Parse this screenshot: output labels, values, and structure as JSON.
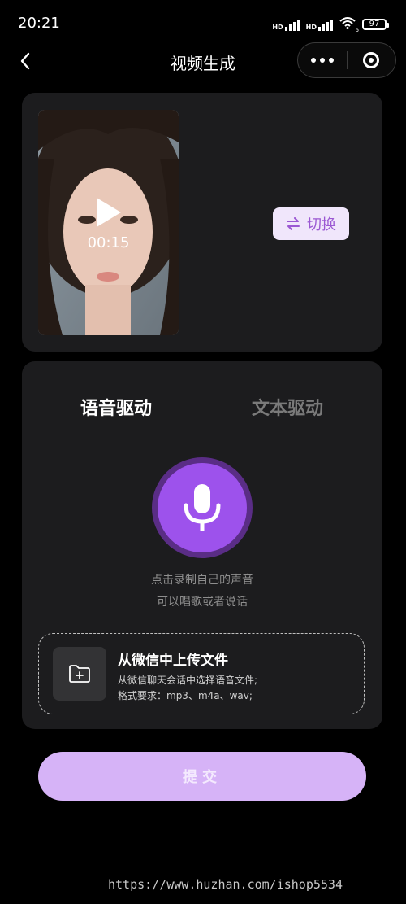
{
  "status_bar": {
    "time": "20:21",
    "network_labels": [
      "HD",
      "HD"
    ],
    "wifi_sub": "6",
    "battery": "97"
  },
  "nav": {
    "title": "视频生成",
    "back_icon": "chevron-left-icon",
    "more_icon": "more-dots-icon",
    "close_icon": "target-circle-icon"
  },
  "video_card": {
    "duration": "00:15",
    "switch_label": "切换",
    "switch_icon": "swap-arrows-icon"
  },
  "audio_card": {
    "tabs": [
      {
        "label": "语音驱动",
        "active": true
      },
      {
        "label": "文本驱动",
        "active": false
      }
    ],
    "hint_line1": "点击录制自己的声音",
    "hint_line2": "可以唱歌或者说话",
    "upload": {
      "title": "从微信中上传文件",
      "desc_line1": "从微信聊天会话中选择语音文件;",
      "desc_line2": "格式要求：mp3、m4a、wav;"
    }
  },
  "submit_label": "提交",
  "watermark": "https://www.huzhan.com/ishop5534",
  "colors": {
    "accent": "#9d52ec",
    "submit_bg": "#d6b3f7",
    "card_bg": "#1c1c1e",
    "switch_text": "#9b58d3"
  }
}
